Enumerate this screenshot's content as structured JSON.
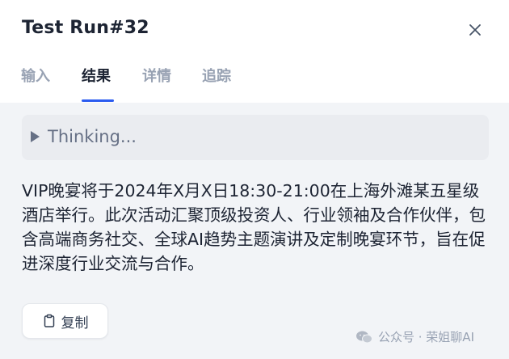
{
  "dialog": {
    "title": "Test Run#32",
    "close_icon": "close-icon"
  },
  "tabs": [
    {
      "label": "输入",
      "active": false
    },
    {
      "label": "结果",
      "active": true
    },
    {
      "label": "详情",
      "active": false
    },
    {
      "label": "追踪",
      "active": false
    }
  ],
  "thinking": {
    "label": "Thinking...",
    "expanded": false,
    "icon": "caret-right-icon"
  },
  "result": {
    "text": "VIP晚宴将于2024年X月X日18:30-21:00在上海外滩某五星级酒店举行。此次活动汇聚顶级投资人、行业领袖及合作伙伴，包含高端商务社交、全球AI趋势主题演讲及定制晚宴环节，旨在促进深度行业交流与合作。"
  },
  "copy_button": {
    "label": "复制",
    "icon": "clipboard-icon"
  },
  "watermark": {
    "text": "公众号 · 荣姐聊AI",
    "icon": "wechat-icon"
  },
  "colors": {
    "accent": "#2b5cf0",
    "title": "#1d2433",
    "tab_inactive": "#98a2b3",
    "content_bg": "#f2f4f7",
    "thinking_bg": "#eaecf0"
  }
}
